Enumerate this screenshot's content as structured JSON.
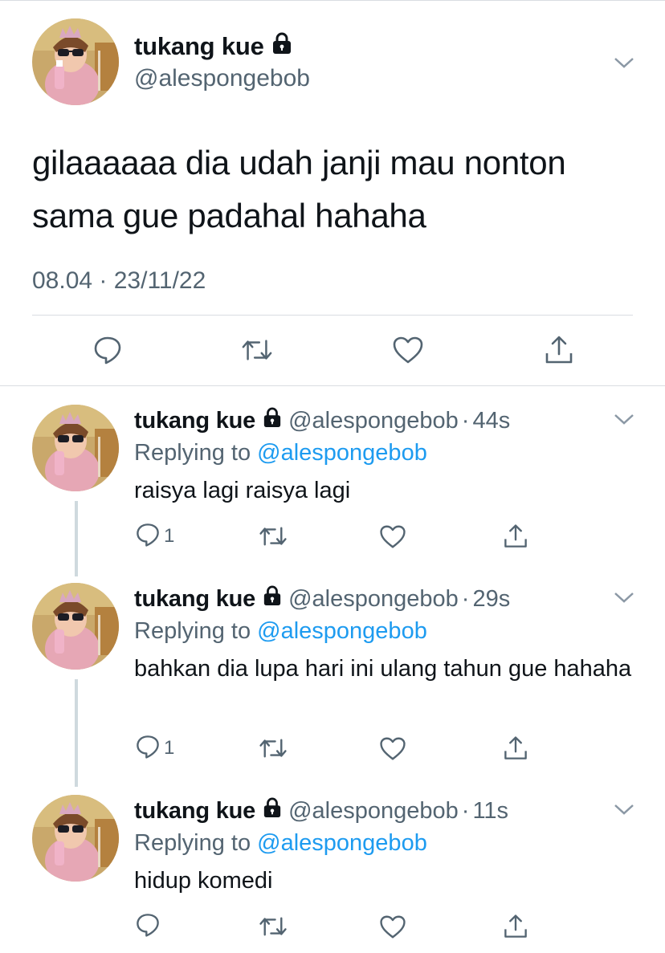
{
  "main_tweet": {
    "author": {
      "name": "tukang kue",
      "handle": "@alespongebob",
      "protected_icon": "lock-icon"
    },
    "text": "gilaaaaaa dia udah janji mau nonton sama gue padahal hahaha",
    "timestamp": "08.04 · 23/11/22",
    "actions": [
      "reply-icon",
      "retweet-icon",
      "like-icon",
      "share-icon"
    ]
  },
  "replies": [
    {
      "name": "tukang kue",
      "handle": "@alespongebob",
      "dot": "·",
      "time": "44s",
      "replying_prefix": "Replying to",
      "replying_to": "@alespongebob",
      "text": "raisya lagi raisya lagi",
      "reply_count": "1"
    },
    {
      "name": "tukang kue",
      "handle": "@alespongebob",
      "dot": "·",
      "time": "29s",
      "replying_prefix": "Replying to",
      "replying_to": "@alespongebob",
      "text": "bahkan dia lupa hari ini ulang tahun gue hahaha",
      "reply_count": "1"
    },
    {
      "name": "tukang kue",
      "handle": "@alespongebob",
      "dot": "·",
      "time": "11s",
      "replying_prefix": "Replying to",
      "replying_to": "@alespongebob",
      "text": "hidup komedi",
      "reply_count": ""
    }
  ],
  "colors": {
    "text": "#0f1419",
    "secondary": "#536471",
    "link": "#1d9bf0",
    "divider": "#d9dde1",
    "thread_line": "#cfd9de"
  }
}
